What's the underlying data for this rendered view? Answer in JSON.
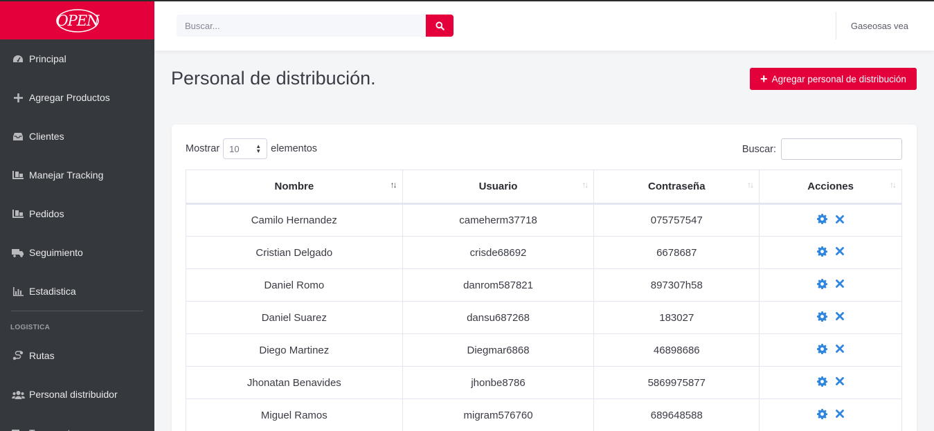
{
  "brand": {
    "logo_text": "OPEN"
  },
  "sidebar": {
    "items": [
      {
        "label": "Principal",
        "icon": "dashboard-icon"
      },
      {
        "label": "Agregar Productos",
        "icon": "plus-icon"
      },
      {
        "label": "Clientes",
        "icon": "inbox-icon"
      },
      {
        "label": "Manejar Tracking",
        "icon": "dolly-icon"
      },
      {
        "label": "Pedidos",
        "icon": "dolly-icon"
      },
      {
        "label": "Seguimiento",
        "icon": "truck-icon"
      },
      {
        "label": "Estadistica",
        "icon": "chart-icon"
      }
    ],
    "section_heading": "LOGISTICA",
    "logistics_items": [
      {
        "label": "Rutas",
        "icon": "route-icon"
      },
      {
        "label": "Personal distribuidor",
        "icon": "users-icon"
      },
      {
        "label": "Transportes",
        "icon": "truck-icon"
      }
    ]
  },
  "topbar": {
    "search_placeholder": "Buscar...",
    "user_name": "Gaseosas vea"
  },
  "page": {
    "title": "Personal de distribución.",
    "add_button_label": "Agregar personal de distribución"
  },
  "table_controls": {
    "show_label": "Mostrar",
    "page_length": "10",
    "elements_label": "elementos",
    "search_label": "Buscar:"
  },
  "table": {
    "headers": [
      "Nombre",
      "Usuario",
      "Contraseña",
      "Acciones"
    ],
    "rows": [
      {
        "nombre": "Camilo Hernandez",
        "usuario": "cameherm37718",
        "contrasena": "075757547"
      },
      {
        "nombre": "Cristian Delgado",
        "usuario": "crisde68692",
        "contrasena": "6678687"
      },
      {
        "nombre": "Daniel Romo",
        "usuario": "danrom587821",
        "contrasena": "897307h58"
      },
      {
        "nombre": "Daniel Suarez",
        "usuario": "dansu687268",
        "contrasena": "183027"
      },
      {
        "nombre": "Diego Martinez",
        "usuario": "Diegmar6868",
        "contrasena": "46898686"
      },
      {
        "nombre": "Jhonatan Benavides",
        "usuario": "jhonbe8786",
        "contrasena": "5869975877"
      },
      {
        "nombre": "Miguel Ramos",
        "usuario": "migram576760",
        "contrasena": "689648588"
      }
    ]
  },
  "colors": {
    "brand_red": "#e4003b",
    "sidebar_bg": "#35383d",
    "action_blue": "#2e86de"
  }
}
